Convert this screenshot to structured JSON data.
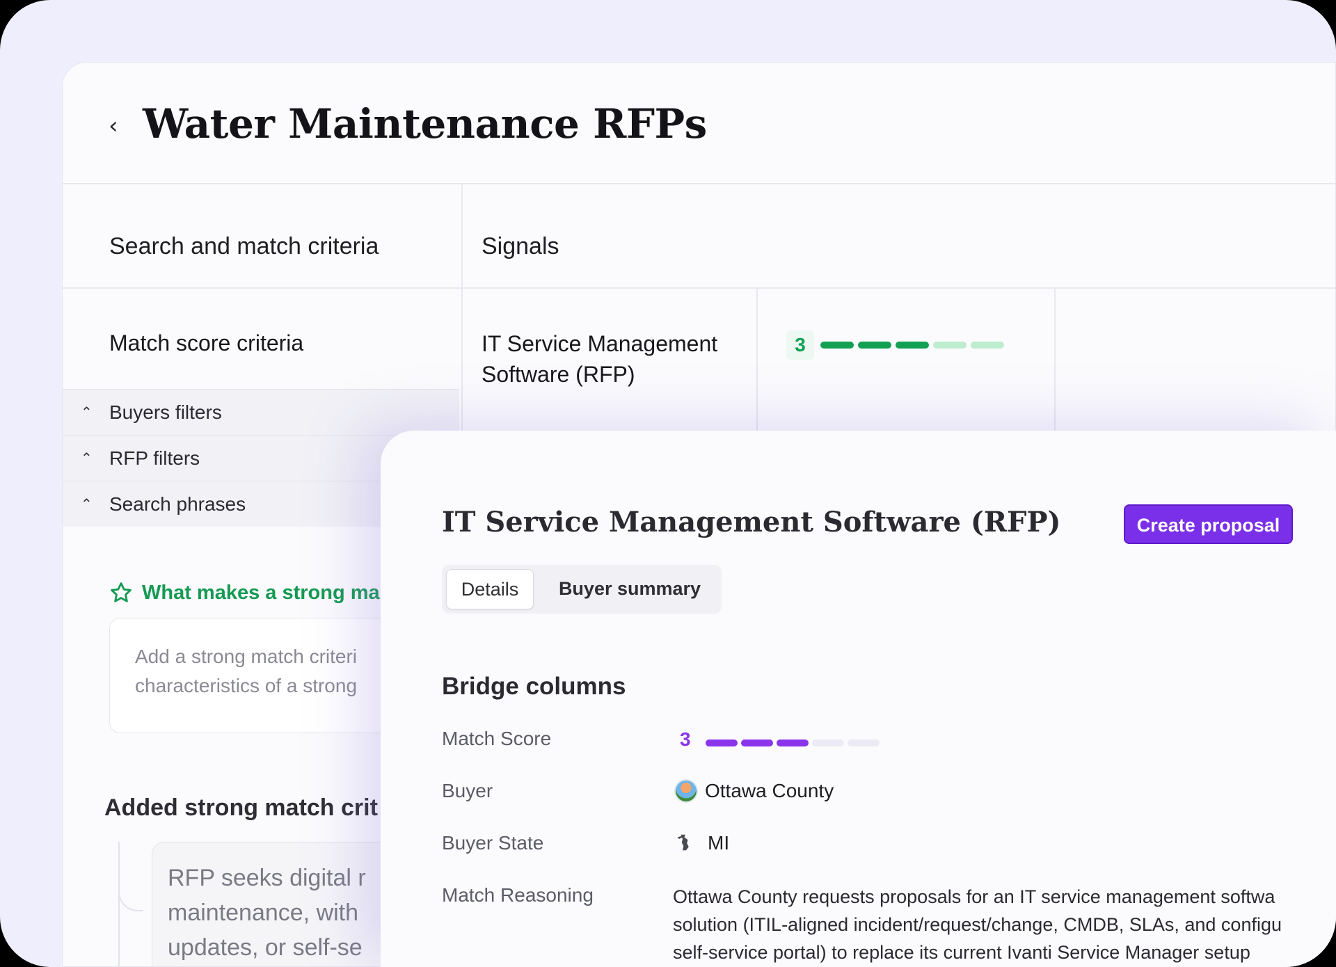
{
  "page": {
    "title": "Water Maintenance RFPs",
    "back_icon": "chevron-left-icon"
  },
  "left": {
    "section_title": "Search and match criteria",
    "match_score_criteria": "Match score criteria",
    "filters": [
      {
        "label": "Buyers filters",
        "icon": "chevron-up-icon"
      },
      {
        "label": "RFP filters",
        "icon": "chevron-up-icon"
      },
      {
        "label": "Search phrases",
        "icon": "chevron-up-icon"
      }
    ],
    "strong_match_link": "What makes a strong ma",
    "strong_match_placeholder_line1": "Add a strong match criteri",
    "strong_match_placeholder_line2": "characteristics of a strong",
    "added_title": "Added strong match crit",
    "added_item_line1": "RFP seeks digital r",
    "added_item_line2": "maintenance, with",
    "added_item_line3": "updates, or self-se"
  },
  "signals": {
    "section_title": "Signals",
    "rows": [
      {
        "name": "IT Service Management Software (RFP)",
        "score": "3",
        "score_value": 3,
        "score_max": 5
      }
    ]
  },
  "detail": {
    "title": "IT Service Management Software (RFP)",
    "create_button": "Create proposal",
    "tabs": [
      {
        "label": "Details",
        "active": true
      },
      {
        "label": "Buyer summary",
        "active": false
      }
    ],
    "bridge_title": "Bridge columns",
    "fields": {
      "match_score_label": "Match Score",
      "match_score": "3",
      "match_score_value": 3,
      "match_score_max": 5,
      "buyer_label": "Buyer",
      "buyer": "Ottawa County",
      "buyer_state_label": "Buyer State",
      "buyer_state": "MI",
      "match_reasoning_label": "Match Reasoning",
      "match_reasoning_line1": "Ottawa County requests proposals for an IT service management softwa",
      "match_reasoning_line2": "solution (ITIL-aligned incident/request/change, CMDB, SLAs, and configu",
      "match_reasoning_line3": "self-service portal) to replace its current Ivanti Service Manager setup"
    }
  },
  "colors": {
    "accent_purple": "#7a2fe8",
    "score_green": "#12a052",
    "score_green_light": "#bdeccf",
    "score_purple": "#8a34ec",
    "score_purple_light": "#ecebf5"
  }
}
